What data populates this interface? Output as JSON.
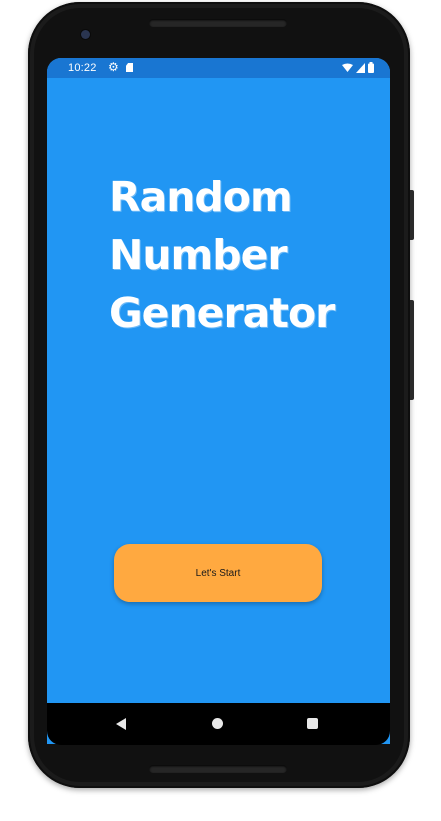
{
  "status_bar": {
    "time": "10:22",
    "icons": [
      "gear-icon",
      "sd-card-icon",
      "wifi-icon",
      "signal-icon",
      "battery-icon"
    ]
  },
  "title": {
    "line1": "Random",
    "line2": "Number",
    "line3": "Generator"
  },
  "start_button": {
    "label": "Let's Start"
  },
  "navigation": {
    "icons": [
      "back-icon",
      "home-icon",
      "recents-icon"
    ]
  },
  "colors": {
    "screen_background": "#2196F3",
    "status_bar": "#1976D2",
    "button": "#FFA940",
    "title_text": "#FFFFFF"
  }
}
